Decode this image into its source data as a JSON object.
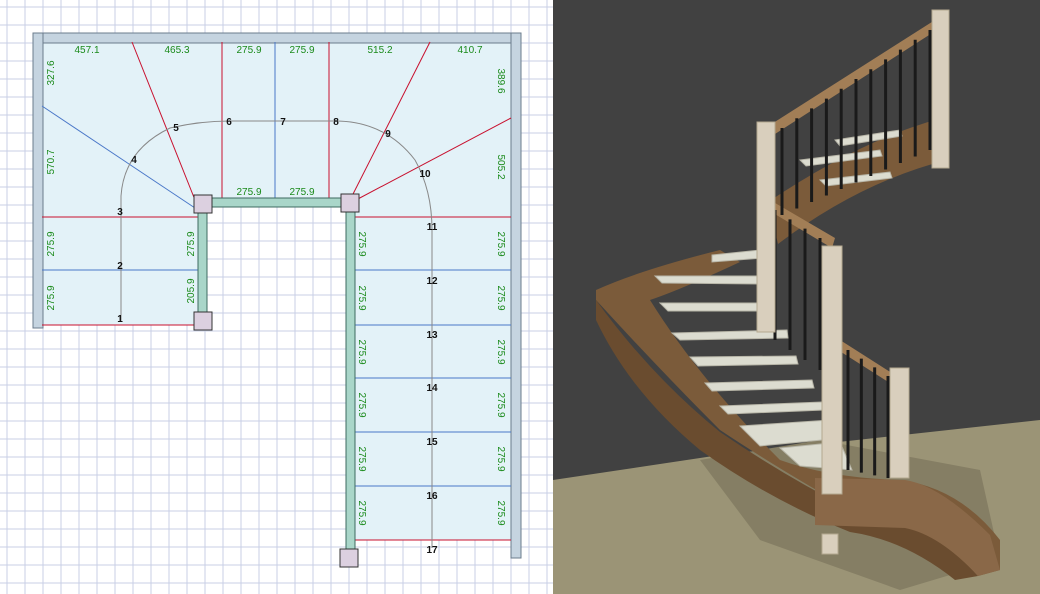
{
  "colors": {
    "grid": "#c8cfe6",
    "floor_fill": "#e3f2f8",
    "wall": "#c5d4e0",
    "stringer": "#a9d6c9",
    "post": "#dcd0e0",
    "red_line": "#c8102e",
    "blue_line": "#4a78c8",
    "dimension_text": "#1a8a1a",
    "render_bg": "#414141",
    "render_floor": "#9b9476",
    "wood": "#7b5b3a",
    "tread": "#dcdcd0",
    "newel": "#d9cfbd",
    "baluster": "#1a1a1a"
  },
  "top_dimensions": [
    "457.1",
    "465.3",
    "275.9",
    "275.9",
    "515.2",
    "410.7"
  ],
  "left_dimensions": [
    "327.6",
    "570.7",
    "275.9",
    "275.9"
  ],
  "right_dimensions": [
    "389.6",
    "505.2",
    "275.9",
    "275.9",
    "275.9",
    "275.9",
    "275.9",
    "275.9"
  ],
  "inner_horizontal_dimensions": [
    "275.9",
    "275.9"
  ],
  "inner_left_dimensions": [
    "275.9",
    "205.9"
  ],
  "inner_right_dimensions": [
    "275.9",
    "275.9",
    "275.9",
    "275.9",
    "275.9",
    "275.9"
  ],
  "step_numbers": [
    "1",
    "2",
    "3",
    "4",
    "5",
    "6",
    "7",
    "8",
    "9",
    "10",
    "11",
    "12",
    "13",
    "14",
    "15",
    "16",
    "17"
  ]
}
